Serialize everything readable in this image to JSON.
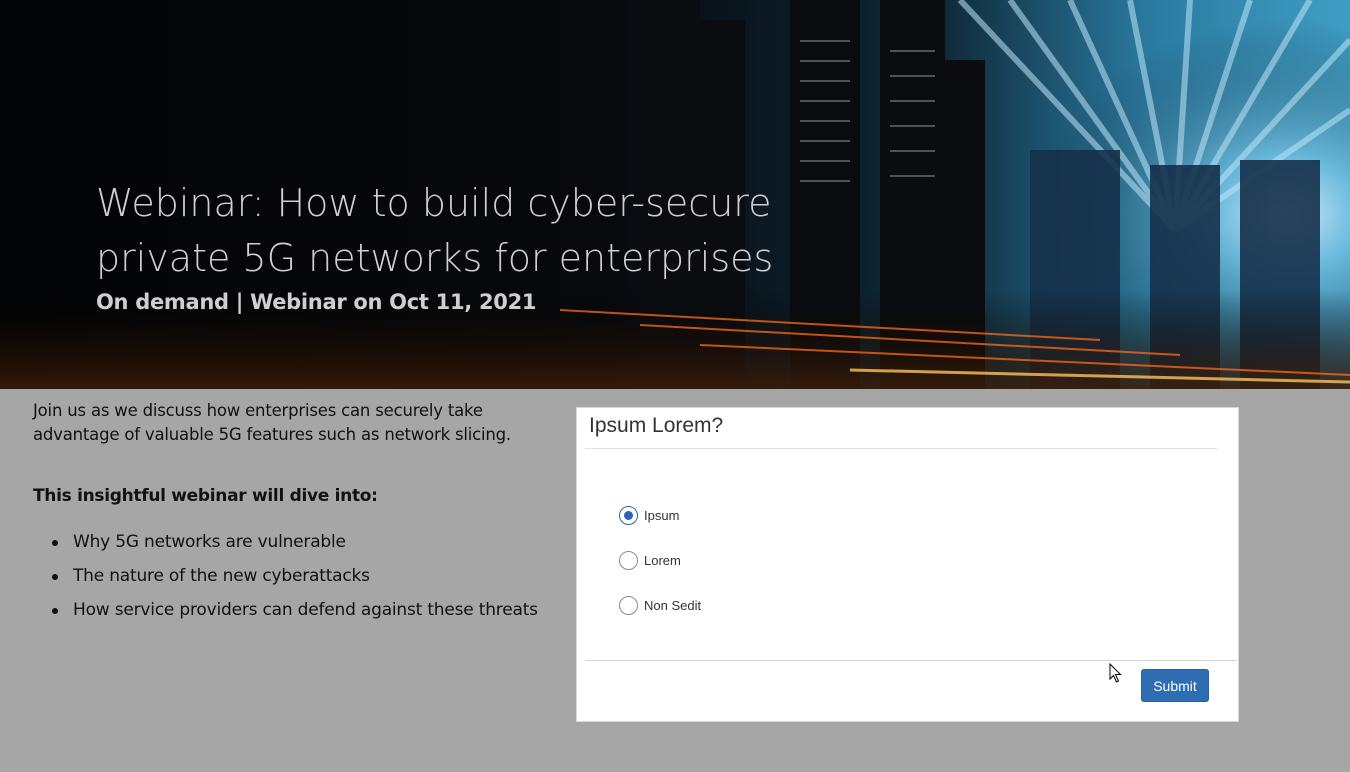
{
  "hero": {
    "title_line1": "Webinar: How to build cyber-secure",
    "title_line2": "private 5G networks for enterprises",
    "subtitle": "On demand | Webinar on Oct 11, 2021"
  },
  "content": {
    "intro_line1": "Join us as we discuss how enterprises can securely take",
    "intro_line2": "advantage of valuable 5G features such as network slicing.",
    "dive_heading": "This insightful webinar will dive into:",
    "bullets": [
      "Why 5G networks are vulnerable",
      "The nature of the new cyberattacks",
      "How service providers can defend against these threats"
    ]
  },
  "modal": {
    "title": "Ipsum Lorem?",
    "options": [
      {
        "label": "Ipsum",
        "checked": true
      },
      {
        "label": "Lorem",
        "checked": false
      },
      {
        "label": "Non Sedit",
        "checked": false
      }
    ],
    "submit_label": "Submit"
  },
  "colors": {
    "page_background": "#a6a6a6",
    "accent": "#2f6db2",
    "hero_text": "#cfcfcf"
  }
}
